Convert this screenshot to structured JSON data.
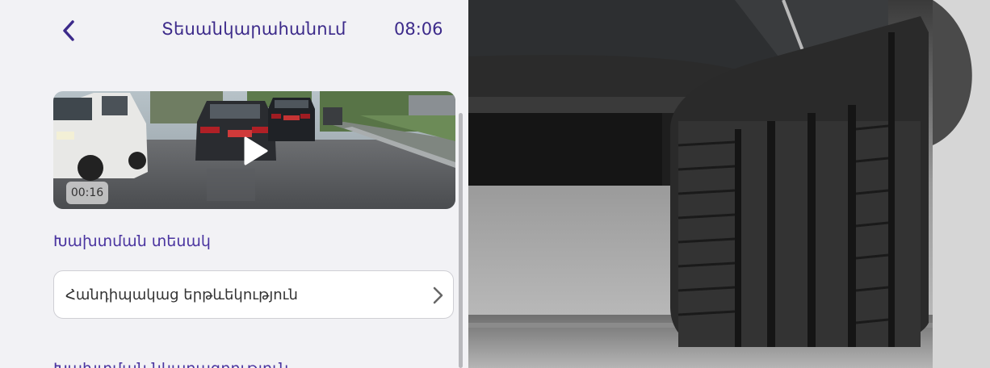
{
  "header": {
    "title": "Տեսանկարահանում",
    "time": "08:06",
    "back_icon": "chevron-left-icon"
  },
  "video": {
    "duration": "00:16",
    "play_icon": "play-icon"
  },
  "incident_type": {
    "label": "Խախտման տեսակ",
    "value": "Հանդիպակաց երթևեկություն",
    "chevron_icon": "chevron-right-icon"
  },
  "next_section": {
    "label": "Խախտման նկարագրություն"
  },
  "colors": {
    "accent": "#3c2a8a",
    "background": "#f2f2f5",
    "field_border": "#cfcfd4"
  }
}
